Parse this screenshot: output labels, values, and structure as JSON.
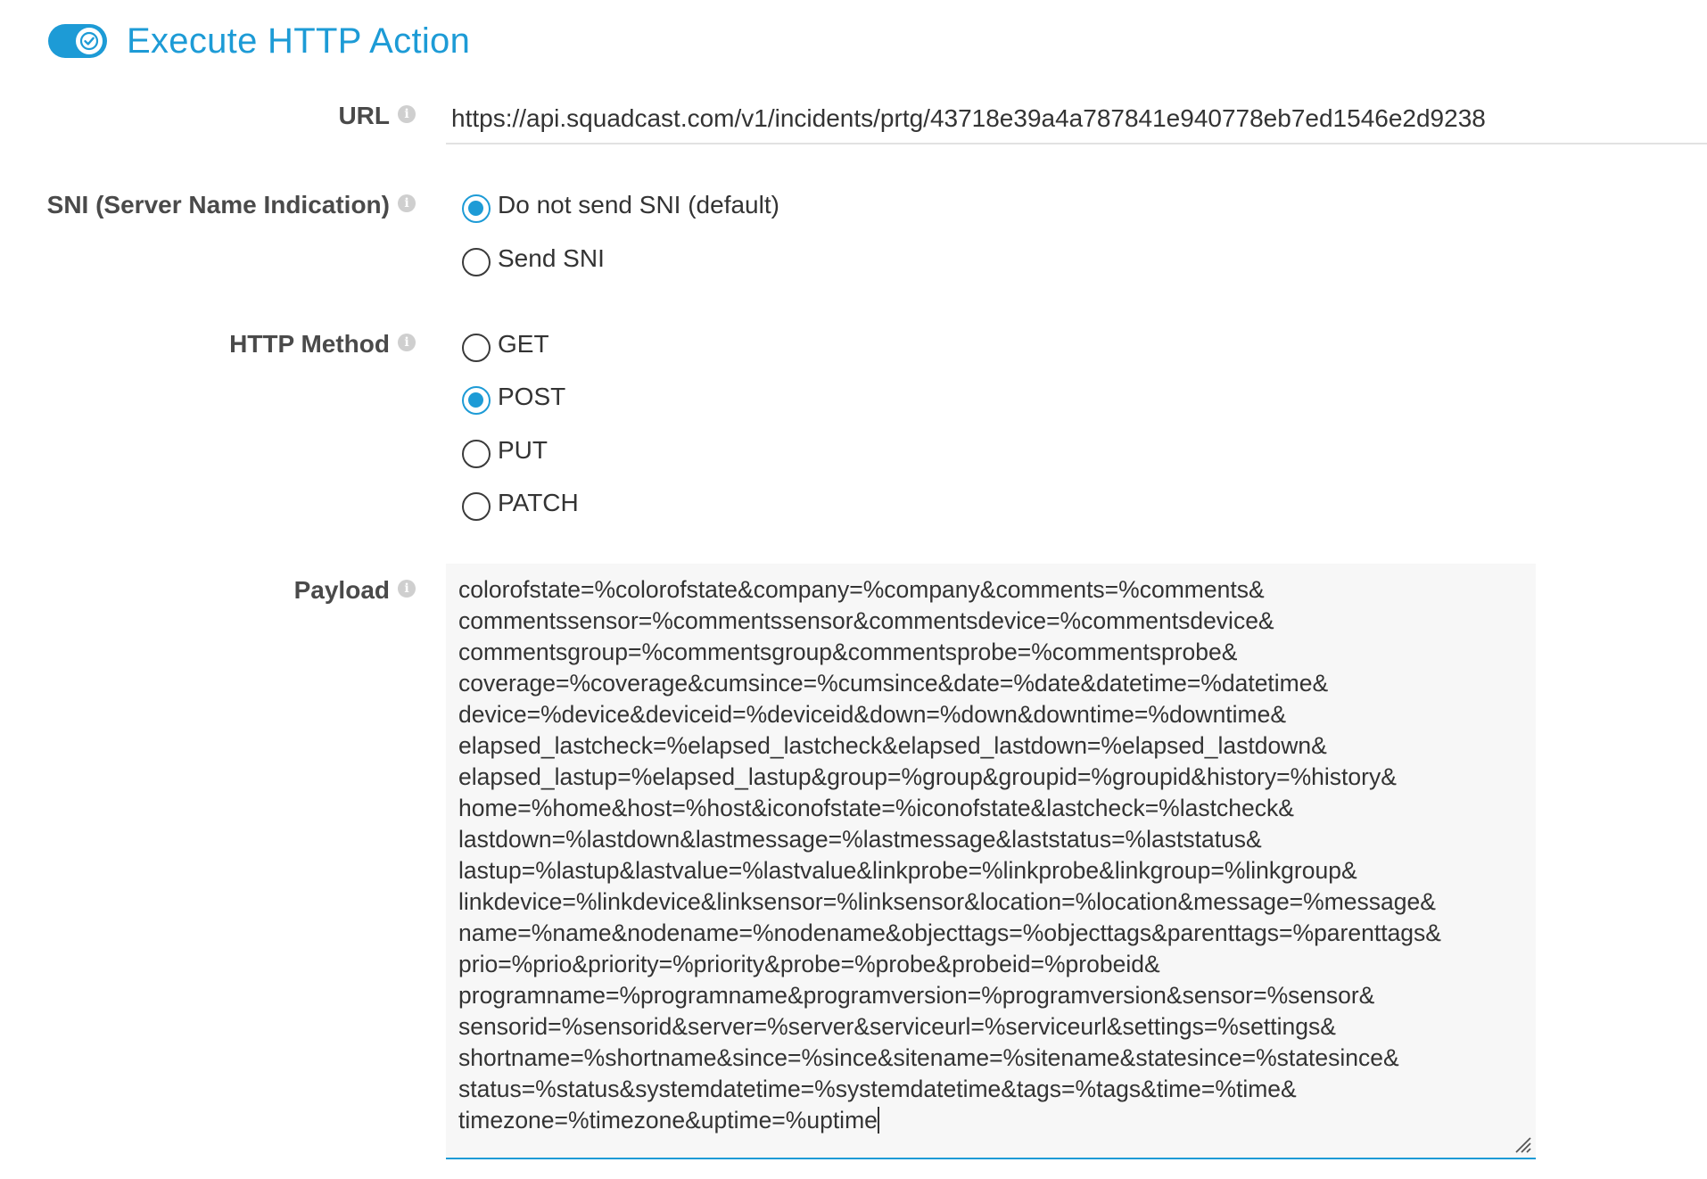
{
  "header": {
    "title": "Execute HTTP Action",
    "toggle_on": true
  },
  "colors": {
    "accent": "#1d9bd6",
    "label": "#4a4a4a",
    "text": "#333333",
    "info_icon": "#cfcfcf"
  },
  "icons": {
    "toggle": "check-icon",
    "info": "info-icon",
    "resize": "resize-grip-icon"
  },
  "url": {
    "label": "URL",
    "value": "https://api.squadcast.com/v1/incidents/prtg/43718e39a4a787841e940778eb7ed1546e2d9238"
  },
  "sni": {
    "label": "SNI (Server Name Indication)",
    "options": [
      {
        "label": "Do not send SNI (default)",
        "checked": true
      },
      {
        "label": "Send SNI",
        "checked": false
      }
    ]
  },
  "http_method": {
    "label": "HTTP Method",
    "options": [
      {
        "label": "GET",
        "checked": false
      },
      {
        "label": "POST",
        "checked": true
      },
      {
        "label": "PUT",
        "checked": false
      },
      {
        "label": "PATCH",
        "checked": false
      }
    ]
  },
  "payload": {
    "label": "Payload",
    "lines": [
      "colorofstate=%colorofstate&company=%company&comments=%comments&",
      "commentssensor=%commentssensor&commentsdevice=%commentsdevice&",
      "commentsgroup=%commentsgroup&commentsprobe=%commentsprobe&",
      "coverage=%coverage&cumsince=%cumsince&date=%date&datetime=%datetime&",
      "device=%device&deviceid=%deviceid&down=%down&downtime=%downtime&",
      "elapsed_lastcheck=%elapsed_lastcheck&elapsed_lastdown=%elapsed_lastdown&",
      "elapsed_lastup=%elapsed_lastup&group=%group&groupid=%groupid&history=%history&",
      "home=%home&host=%host&iconofstate=%iconofstate&lastcheck=%lastcheck&",
      "lastdown=%lastdown&lastmessage=%lastmessage&laststatus=%laststatus&",
      "lastup=%lastup&lastvalue=%lastvalue&linkprobe=%linkprobe&linkgroup=%linkgroup&",
      "linkdevice=%linkdevice&linksensor=%linksensor&location=%location&message=%message&",
      "name=%name&nodename=%nodename&objecttags=%objecttags&parenttags=%parenttags&",
      "prio=%prio&priority=%priority&probe=%probe&probeid=%probeid&",
      "programname=%programname&programversion=%programversion&sensor=%sensor&",
      "sensorid=%sensorid&server=%server&serviceurl=%serviceurl&settings=%settings&",
      "shortname=%shortname&since=%since&sitename=%sitename&statesince=%statesince&",
      "status=%status&systemdatetime=%systemdatetime&tags=%tags&time=%time&",
      "timezone=%timezone&uptime=%uptime"
    ]
  }
}
